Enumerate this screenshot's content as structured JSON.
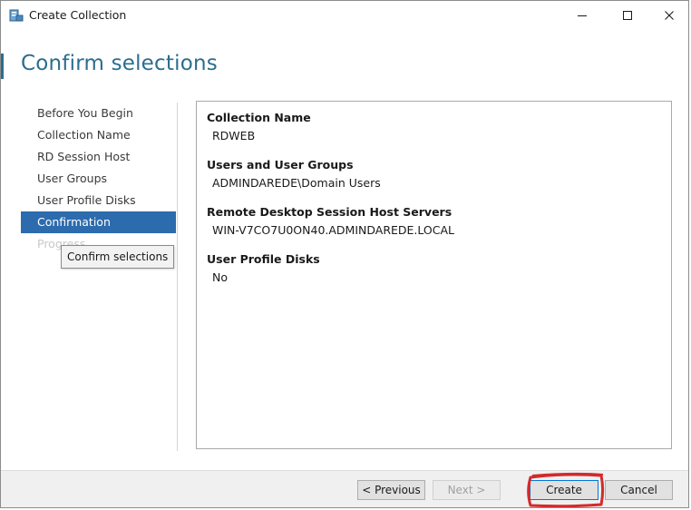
{
  "window": {
    "title": "Create Collection"
  },
  "page": {
    "heading": "Confirm selections"
  },
  "nav": {
    "items": [
      {
        "label": "Before You Begin"
      },
      {
        "label": "Collection Name"
      },
      {
        "label": "RD Session Host"
      },
      {
        "label": "User Groups"
      },
      {
        "label": "User Profile Disks"
      },
      {
        "label": "Confirmation"
      },
      {
        "label": "Progress"
      }
    ],
    "active_index": 5
  },
  "tooltip": {
    "text": "Confirm selections"
  },
  "summary": {
    "sections": [
      {
        "label": "Collection Name",
        "value": "RDWEB"
      },
      {
        "label": "Users and User Groups",
        "value": "ADMINDAREDE\\Domain Users"
      },
      {
        "label": "Remote Desktop Session Host Servers",
        "value": "WIN-V7CO7U0ON40.ADMINDAREDE.LOCAL"
      },
      {
        "label": "User Profile Disks",
        "value": "No"
      }
    ]
  },
  "buttons": {
    "previous": "< Previous",
    "next": "Next >",
    "create": "Create",
    "cancel": "Cancel"
  },
  "icons": {
    "app": "server-manager-icon",
    "minimize": "minimize-icon",
    "maximize": "maximize-icon",
    "close": "close-icon"
  },
  "colors": {
    "accent": "#2b6e8e",
    "selection": "#2c6bad",
    "annotation": "#d42a2a"
  }
}
